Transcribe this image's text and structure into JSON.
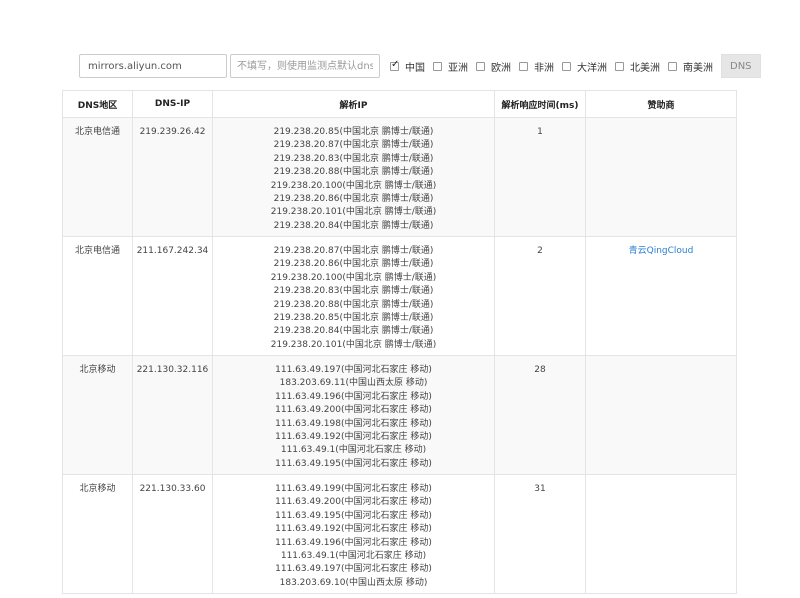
{
  "toolbar": {
    "domain_value": "mirrors.aliyun.com",
    "dns_placeholder": "不填写，则使用监测点默认dns",
    "regions": [
      {
        "label": "中国",
        "checked": true
      },
      {
        "label": "亚洲",
        "checked": false
      },
      {
        "label": "欧洲",
        "checked": false
      },
      {
        "label": "非洲",
        "checked": false
      },
      {
        "label": "大洋洲",
        "checked": false
      },
      {
        "label": "北美洲",
        "checked": false
      },
      {
        "label": "南美洲",
        "checked": false
      }
    ],
    "dns_button": "DNS"
  },
  "table": {
    "headers": [
      "DNS地区",
      "DNS-IP",
      "解析IP",
      "解析响应时间(ms)",
      "赞助商"
    ],
    "rows": [
      {
        "region": "北京电信通",
        "dns_ip": "219.239.26.42",
        "ips": [
          "219.238.20.85(中国北京 鹏博士/联通)",
          "219.238.20.87(中国北京 鹏博士/联通)",
          "219.238.20.83(中国北京 鹏博士/联通)",
          "219.238.20.88(中国北京 鹏博士/联通)",
          "219.238.20.100(中国北京 鹏博士/联通)",
          "219.238.20.86(中国北京 鹏博士/联通)",
          "219.238.20.101(中国北京 鹏博士/联通)",
          "219.238.20.84(中国北京 鹏博士/联通)"
        ],
        "time": "1",
        "sponsor": ""
      },
      {
        "region": "北京电信通",
        "dns_ip": "211.167.242.34",
        "ips": [
          "219.238.20.87(中国北京 鹏博士/联通)",
          "219.238.20.86(中国北京 鹏博士/联通)",
          "219.238.20.100(中国北京 鹏博士/联通)",
          "219.238.20.83(中国北京 鹏博士/联通)",
          "219.238.20.88(中国北京 鹏博士/联通)",
          "219.238.20.85(中国北京 鹏博士/联通)",
          "219.238.20.84(中国北京 鹏博士/联通)",
          "219.238.20.101(中国北京 鹏博士/联通)"
        ],
        "time": "2",
        "sponsor": "青云QingCloud"
      },
      {
        "region": "北京移动",
        "dns_ip": "221.130.32.116",
        "ips": [
          "111.63.49.197(中国河北石家庄 移动)",
          "183.203.69.11(中国山西太原 移动)",
          "111.63.49.196(中国河北石家庄 移动)",
          "111.63.49.200(中国河北石家庄 移动)",
          "111.63.49.198(中国河北石家庄 移动)",
          "111.63.49.192(中国河北石家庄 移动)",
          "111.63.49.1(中国河北石家庄 移动)",
          "111.63.49.195(中国河北石家庄 移动)"
        ],
        "time": "28",
        "sponsor": ""
      },
      {
        "region": "北京移动",
        "dns_ip": "221.130.33.60",
        "ips": [
          "111.63.49.199(中国河北石家庄 移动)",
          "111.63.49.200(中国河北石家庄 移动)",
          "111.63.49.195(中国河北石家庄 移动)",
          "111.63.49.192(中国河北石家庄 移动)",
          "111.63.49.196(中国河北石家庄 移动)",
          "111.63.49.1(中国河北石家庄 移动)",
          "111.63.49.197(中国河北石家庄 移动)",
          "183.203.69.10(中国山西太原 移动)"
        ],
        "time": "31",
        "sponsor": ""
      }
    ]
  },
  "colors": {
    "link": "#2a7fd4",
    "border": "#e4e4e4",
    "row_alt": "#f9f9f9"
  }
}
